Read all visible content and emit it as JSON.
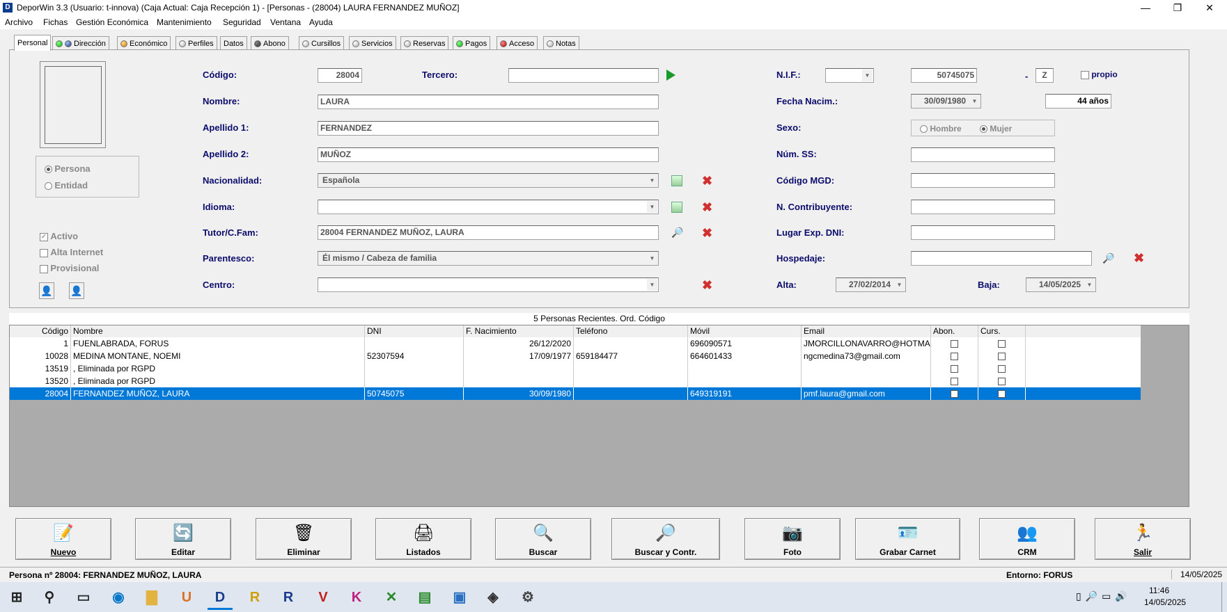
{
  "window": {
    "title": "DeporWin 3.3  (Usuario: t-innova)  (Caja Actual: Caja Recepción 1) - [Personas - (28004) LAURA FERNANDEZ MUÑOZ]",
    "icon": "D"
  },
  "menu": [
    "Archivo",
    "Fichas",
    "Gestión Económica",
    "Mantenimiento",
    "Seguridad",
    "Ventana",
    "Ayuda"
  ],
  "tabs": [
    "Personal",
    "Dirección",
    "Económico",
    "Perfiles",
    "Datos",
    "Abono",
    "Cursillos",
    "Servicios",
    "Reservas",
    "Pagos",
    "Acceso",
    "Notas"
  ],
  "form": {
    "codigo_label": "Código:",
    "codigo": "28004",
    "tercero_label": "Tercero:",
    "tercero": "",
    "nombre_label": "Nombre:",
    "nombre": "LAURA",
    "apellido1_label": "Apellido 1:",
    "apellido1": "FERNANDEZ",
    "apellido2_label": "Apellido 2:",
    "apellido2": "MUÑOZ",
    "nacionalidad_label": "Nacionalidad:",
    "nacionalidad": "Española",
    "idioma_label": "Idioma:",
    "idioma": "",
    "tutor_label": "Tutor/C.Fam:",
    "tutor": "28004 FERNANDEZ MUÑOZ, LAURA",
    "parentesco_label": "Parentesco:",
    "parentesco": "Él mismo / Cabeza de familia",
    "centro_label": "Centro:",
    "centro": "",
    "nif_label": "N.I.F.:",
    "nif_tipo": "",
    "nif": "50745075",
    "nif_dash": "-",
    "nif_letra": "Z",
    "propio_label": "propio",
    "fecha_nac_label": "Fecha Nacim.:",
    "fecha_nac": "30/09/1980",
    "edad": "44 años",
    "sexo_label": "Sexo:",
    "hombre": "Hombre",
    "mujer": "Mujer",
    "numss_label": "Núm. SS:",
    "numss": "",
    "mgd_label": "Código MGD:",
    "mgd": "",
    "contrib_label": "N. Contribuyente:",
    "contrib": "",
    "lugarexp_label": "Lugar Exp. DNI:",
    "lugarexp": "",
    "hospedaje_label": "Hospedaje:",
    "hospedaje": "",
    "alta_label": "Alta:",
    "alta": "27/02/2014",
    "baja_label": "Baja:",
    "baja": "14/05/2025",
    "persona": "Persona",
    "entidad": "Entidad",
    "activo": "Activo",
    "alta_internet": "Alta Internet",
    "provisional": "Provisional"
  },
  "list": {
    "title": "5 Personas Recientes. Ord. Código",
    "headers": [
      "Código",
      "Nombre",
      "DNI",
      "F. Nacimiento",
      "Teléfono",
      "Móvil",
      "Email",
      "Abon.",
      "Curs."
    ],
    "rows": [
      [
        "1",
        "FUENLABRADA, FORUS",
        "",
        "26/12/2020",
        "",
        "696090571",
        "JMORCILLONAVARRO@HOTMAIL.CO"
      ],
      [
        "10028",
        "MEDINA MONTANE, NOEMI",
        "52307594",
        "17/09/1977",
        "659184477",
        "664601433",
        "ngcmedina73@gmail.com"
      ],
      [
        "13519",
        ", Eliminada por RGPD",
        "",
        "",
        "",
        "",
        ""
      ],
      [
        "13520",
        ", Eliminada por RGPD",
        "",
        "",
        "",
        "",
        ""
      ],
      [
        "28004",
        "FERNANDEZ MUÑOZ, LAURA",
        "50745075",
        "30/09/1980",
        "",
        "649319191",
        "pmf.laura@gmail.com"
      ]
    ]
  },
  "buttons": [
    "Nuevo",
    "Editar",
    "Eliminar",
    "Listados",
    "Buscar",
    "Buscar y Contr.",
    "Foto",
    "Grabar Carnet",
    "CRM",
    "Salir"
  ],
  "status": {
    "left": "Persona nº 28004: FERNANDEZ MUÑOZ, LAURA",
    "entorno": "Entorno: FORUS",
    "date": "14/05/2025"
  },
  "taskbar": {
    "time": "11:46",
    "date": "14/05/2025"
  }
}
